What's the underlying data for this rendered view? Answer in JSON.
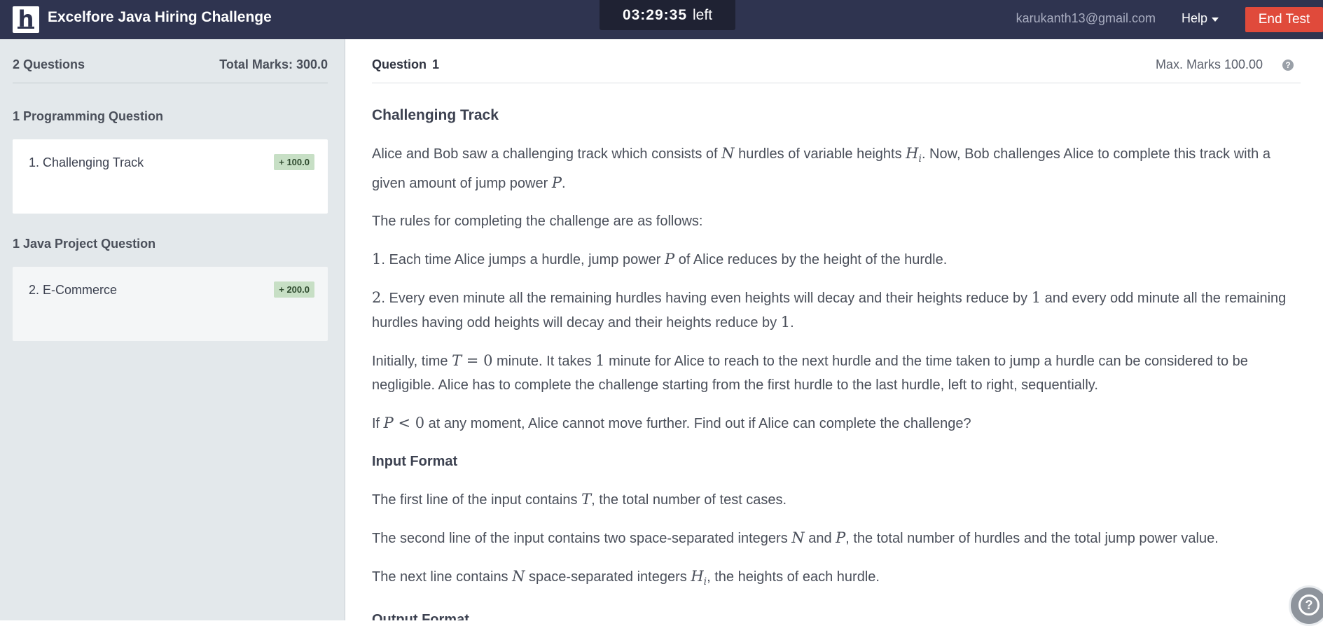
{
  "header": {
    "logo_letter": "h",
    "title": "Excelfore Java Hiring Challenge",
    "timer": "03:29:35",
    "timer_suffix": "left",
    "email": "karukanth13@gmail.com",
    "help_label": "Help",
    "end_test_label": "End Test"
  },
  "sidebar": {
    "questions_count": "2 Questions",
    "total_marks": "Total Marks: 300.0",
    "sections": [
      {
        "title": "1 Programming Question",
        "items": [
          {
            "label": "1. Challenging Track",
            "marks": "+ 100.0"
          }
        ]
      },
      {
        "title": "1 Java Project Question",
        "items": [
          {
            "label": "2. E-Commerce",
            "marks": "+ 200.0"
          }
        ]
      }
    ]
  },
  "question": {
    "label": "Question",
    "number": "1",
    "max_marks": "Max. Marks 100.00",
    "title": "Challenging Track",
    "p1": {
      "a": "Alice and Bob saw a challenging track which consists of ",
      "N": "N",
      "b": " hurdles of variable heights ",
      "H": "H",
      "i": "i",
      "c": ". Now, Bob challenges Alice to complete this track with a given amount of jump power ",
      "P": "P",
      "d": "."
    },
    "p2": "The rules for completing the challenge are as follows:",
    "p3": {
      "num": "1",
      "a": ". Each time Alice jumps a hurdle, jump power ",
      "P": "P",
      "b": " of Alice reduces by the height of the hurdle."
    },
    "p4": {
      "num": "2",
      "a": ". Every even minute all the remaining hurdles having even heights will decay and their heights reduce by ",
      "one": "1",
      "b": " and every odd minute all the remaining hurdles having odd heights will decay and their heights reduce by ",
      "one2": "1",
      "c": "."
    },
    "p5": {
      "a": "Initially, time ",
      "T": "T",
      "eq": " = 0",
      "b": " minute. It takes ",
      "one": "1",
      "c": " minute for Alice to reach to the next hurdle and the time taken to jump a hurdle can be considered to be negligible. Alice has to complete the challenge starting from the first hurdle to the last hurdle, left to right, sequentially."
    },
    "p6": {
      "a": "If ",
      "P": "P",
      "lt": " < 0",
      "b": " at any moment, Alice cannot move further. Find out if Alice can complete the challenge?"
    },
    "input_format_title": "Input Format",
    "in1": {
      "a": "The first line of the input contains ",
      "T": "T",
      "b": ", the total number of test cases."
    },
    "in2": {
      "a": "The second line of the input contains two space-separated integers ",
      "N": "N",
      "and": " and ",
      "P": "P",
      "b": ", the total number of hurdles and the total jump power value."
    },
    "in3": {
      "a": "The next line contains ",
      "N": "N",
      "b": " space-separated integers ",
      "H": "H",
      "i": "i",
      "c": ", the heights of each hurdle."
    },
    "output_format_title": "Output Format"
  },
  "colors": {
    "topbar": "#2f3450",
    "end_test": "#e04a3b",
    "sidebar": "#e3e8eb",
    "badge": "#c7dfc5"
  },
  "icons": {
    "help_caret": "chevron-down-icon",
    "marks_help": "question-circle-icon",
    "support": "question-circle-icon"
  }
}
